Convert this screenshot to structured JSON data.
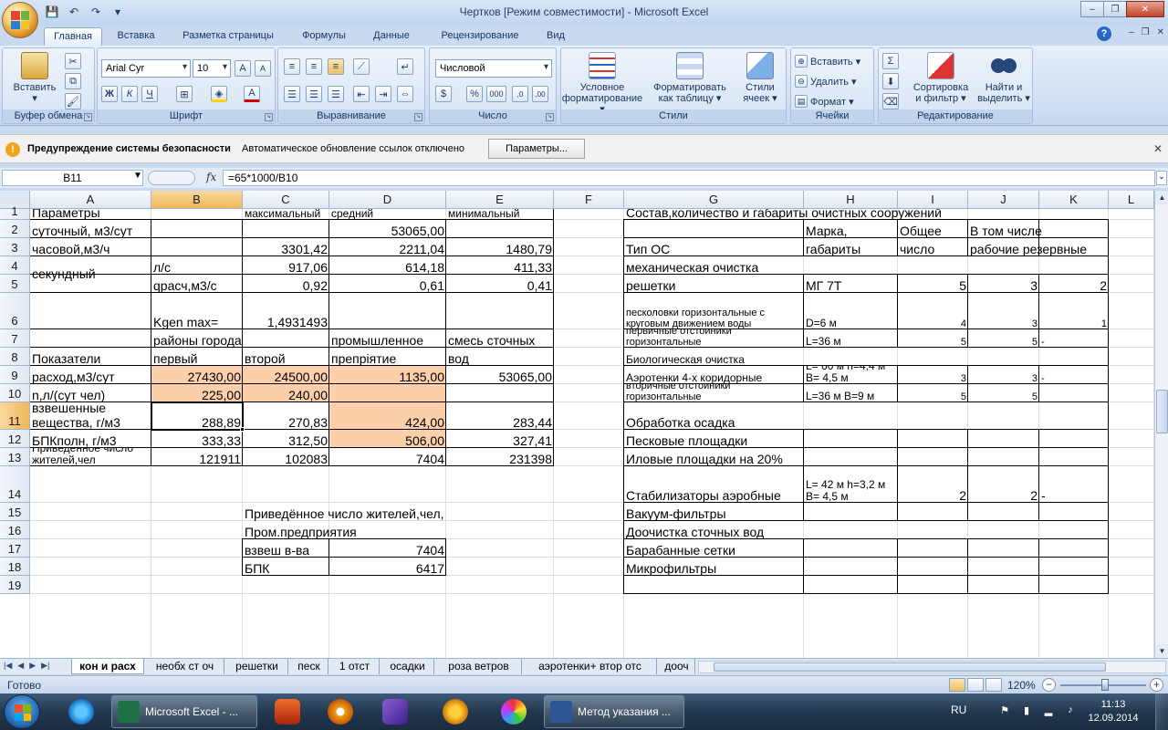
{
  "window": {
    "title": "Чертков  [Режим совместимости] - Microsoft Excel",
    "controls": [
      "–",
      "❐",
      "✕"
    ]
  },
  "ribbon_tabs": [
    "Главная",
    "Вставка",
    "Разметка страницы",
    "Формулы",
    "Данные",
    "Рецензирование",
    "Вид"
  ],
  "ribbon": {
    "clipboard": {
      "label": "Буфер обмена",
      "paste": "Вставить"
    },
    "font": {
      "label": "Шрифт",
      "font_name": "Arial Cyr",
      "font_size": "10",
      "bold": "Ж",
      "italic": "К",
      "underline": "Ч"
    },
    "alignment": {
      "label": "Выравнивание"
    },
    "number": {
      "label": "Число",
      "format": "Числовой",
      "percent": "%",
      "thousands": "000"
    },
    "styles": {
      "label": "Стили",
      "conditional": [
        "Условное",
        "форматирование ▾"
      ],
      "as_table": [
        "Форматировать",
        "как таблицу ▾"
      ],
      "cell_styles": [
        "Стили",
        "ячеек ▾"
      ]
    },
    "cells": {
      "label": "Ячейки",
      "insert": "Вставить ▾",
      "delete": "Удалить ▾",
      "format": "Формат ▾"
    },
    "editing": {
      "label": "Редактирование",
      "sort": [
        "Сортировка",
        "и фильтр ▾"
      ],
      "find": [
        "Найти и",
        "выделить ▾"
      ]
    }
  },
  "security_bar": {
    "title": "Предупреждение системы безопасности",
    "message": "Автоматическое обновление ссылок отключено",
    "button": "Параметры..."
  },
  "formula_bar": {
    "name_box": "B11",
    "fx": "fx",
    "formula": "=65*1000/B10"
  },
  "columns": [
    "A",
    "B",
    "C",
    "D",
    "E",
    "F",
    "G",
    "H",
    "I",
    "J",
    "K",
    "L"
  ],
  "rows": [
    "1",
    "2",
    "3",
    "4",
    "5",
    "6",
    "7",
    "8",
    "9",
    "10",
    "11",
    "12",
    "13",
    "14",
    "15",
    "16",
    "17",
    "18",
    "19"
  ],
  "cells": {
    "A1": "Параметры",
    "C1": "максимальный",
    "D1": "средний",
    "E1": "минимальный",
    "G1": "Состав,количество и габариты очистных сооружений",
    "A2": "суточный, м3/сут",
    "D2": "53065,00",
    "H2": "Марка,",
    "I2": "Общее",
    "J2": "В том числе",
    "A3": "часовой,м3/ч",
    "C3": "3301,42",
    "D3": "2211,04",
    "E3": "1480,79",
    "G3": "Тип ОС",
    "H3": "габариты",
    "I3": "число",
    "J3": "рабочие резервные",
    "A4": "секундный",
    "B4": "л/с",
    "C4": "917,06",
    "D4": "614,18",
    "E4": "411,33",
    "G4": "механическая очистка",
    "B5": "qрасч,м3/с",
    "C5": "0,92",
    "D5": "0,61",
    "E5": "0,41",
    "G5": "решетки",
    "H5": "МГ 7Т",
    "I5": "5",
    "J5": "3",
    "K5": "2",
    "B6": "Kgen max=",
    "C6": "1,4931493",
    "G6": "песколовки горизонтальные с круговым движением воды",
    "H6": "D=6 м",
    "I6": "4",
    "J6": "3",
    "K6": "1",
    "B7": "районы города",
    "D7": "промышленное",
    "E7": "смесь сточных",
    "G7": "первичные отстойники горизонтальные",
    "H7": "L=36 м",
    "I7": "5",
    "J7": "5",
    "K7": "-",
    "A8": "Показатели",
    "B8": "первый",
    "C8": "второй",
    "D8": "препріятие",
    "E8": "вод",
    "G8": "Биологическая очистка",
    "A9": "расход,м3/сут",
    "B9": "27430,00",
    "C9": "24500,00",
    "D9": "1135,00",
    "E9": "53065,00",
    "G9": "Аэротенки 4-х коридорные",
    "H9": "L= 60 м h=4,4 м B= 4,5 м",
    "I9": "3",
    "J9": "3",
    "K9": "-",
    "A10": "n,л/(сут чел)",
    "B10": "225,00",
    "C10": "240,00",
    "G10": "вторичные отстойники горизонтальные",
    "H10": "L=36 м B=9 м",
    "I10": "5",
    "J10": "5",
    "A11": "взвешенные вещества, г/м3",
    "B11": "288,89",
    "C11": "270,83",
    "D11": "424,00",
    "E11": "283,44",
    "G11": "Обработка осадка",
    "A12": "БПКполн, г/м3",
    "B12": "333,33",
    "C12": "312,50",
    "D12": "506,00",
    "E12": "327,41",
    "G12": "Песковые площадки",
    "A13": "Приведённое число жителей,чел",
    "B13": "121911",
    "C13": "102083",
    "D13": "7404",
    "E13": "231398",
    "G13": "Иловые площадки на 20%",
    "G14": "Стабилизаторы аэробные",
    "H14": "L= 42 м h=3,2 м B= 4,5 м",
    "I14": "2",
    "J14": "2",
    "K14": "-",
    "C15": "Приведённое число жителей,чел,",
    "G15": "Вакуум-фильтры",
    "C16": "Пром.предприятия",
    "G16": "Доочистка сточных вод",
    "C17": "взвеш в-ва",
    "D17": "7404",
    "G17": "Барабанные сетки",
    "C18": "БПК",
    "D18": "6417",
    "G18": "Микрофильтры"
  },
  "sheet_tabs": [
    "кон и расх",
    "необх ст оч",
    "решетки",
    "песк",
    "1 отст",
    "осадки",
    "роза ветров",
    "аэротенки+ втор отс",
    "дооч"
  ],
  "status": {
    "text": "Готово",
    "zoom": "120%"
  },
  "taskbar": {
    "tasks": [
      "Microsoft Excel - ...",
      "Метод указания ..."
    ],
    "lang": "RU",
    "time": "11:13",
    "date": "12.09.2014"
  }
}
